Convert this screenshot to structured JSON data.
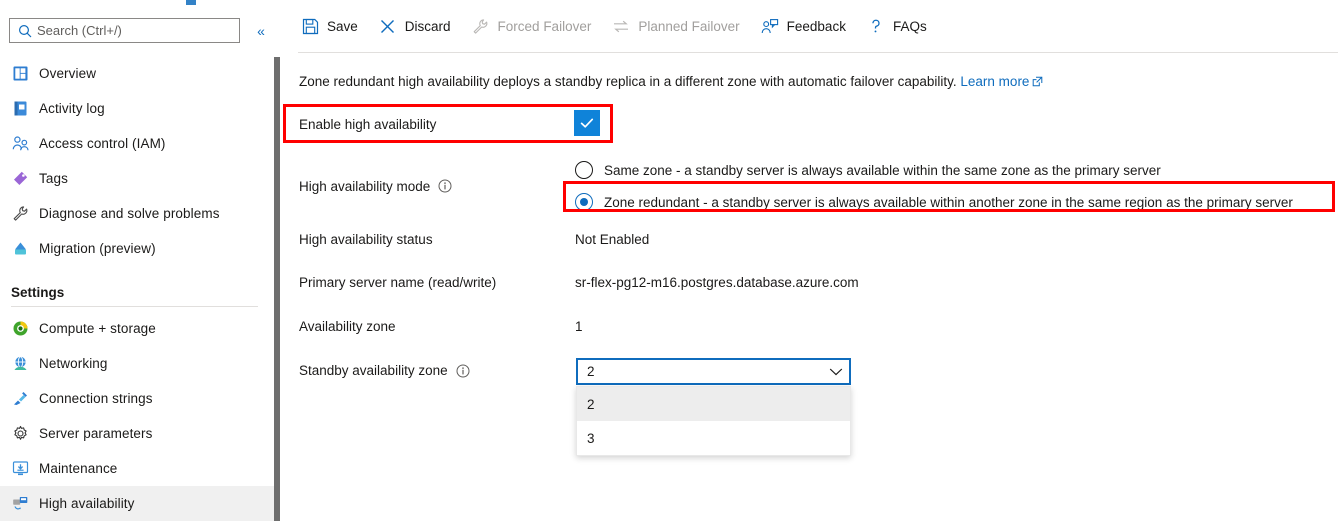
{
  "sidebar": {
    "search": {
      "placeholder": "Search (Ctrl+/)",
      "value": "",
      "icon": "search-icon"
    },
    "collapse_label": "«",
    "items": [
      {
        "label": "Overview",
        "icon": "overview-icon"
      },
      {
        "label": "Activity log",
        "icon": "activity-log-icon"
      },
      {
        "label": "Access control (IAM)",
        "icon": "access-control-icon"
      },
      {
        "label": "Tags",
        "icon": "tag-icon"
      },
      {
        "label": "Diagnose and solve problems",
        "icon": "wrench-icon"
      },
      {
        "label": "Migration (preview)",
        "icon": "migration-icon"
      }
    ],
    "section_title": "Settings",
    "settings_items": [
      {
        "label": "Compute + storage",
        "icon": "compute-storage-icon",
        "selected": false
      },
      {
        "label": "Networking",
        "icon": "networking-icon",
        "selected": false
      },
      {
        "label": "Connection strings",
        "icon": "connection-strings-icon",
        "selected": false
      },
      {
        "label": "Server parameters",
        "icon": "gear-icon",
        "selected": false
      },
      {
        "label": "Maintenance",
        "icon": "maintenance-icon",
        "selected": false
      },
      {
        "label": "High availability",
        "icon": "high-availability-icon",
        "selected": true
      }
    ]
  },
  "toolbar": {
    "save_label": "Save",
    "discard_label": "Discard",
    "forced_failover_label": "Forced Failover",
    "planned_failover_label": "Planned Failover",
    "feedback_label": "Feedback",
    "faqs_label": "FAQs"
  },
  "main": {
    "description_text": "Zone redundant high availability deploys a standby replica in a different zone with automatic failover capability.",
    "learn_more_label": "Learn more",
    "enable_ha": {
      "label": "Enable high availability",
      "checked": true
    },
    "ha_mode": {
      "label": "High availability mode",
      "options": [
        {
          "label": "Same zone - a standby server is always available within the same zone as the primary server",
          "selected": false
        },
        {
          "label": "Zone redundant - a standby server is always available within another zone in the same region as the primary server",
          "selected": true
        }
      ]
    },
    "ha_status": {
      "label": "High availability status",
      "value": "Not Enabled"
    },
    "primary_server": {
      "label": "Primary server name (read/write)",
      "value": "sr-flex-pg12-m16.postgres.database.azure.com"
    },
    "availability_zone": {
      "label": "Availability zone",
      "value": "1"
    },
    "standby_zone": {
      "label": "Standby availability zone",
      "value": "2",
      "options": [
        {
          "label": "2",
          "active": true
        },
        {
          "label": "3",
          "active": false
        }
      ]
    }
  },
  "colors": {
    "accent": "#0f6cbd",
    "checkbox": "#0f83d9",
    "annotation": "#ff0000",
    "disabled_text": "#a19f9d",
    "selected_row": "#f0f0f0"
  }
}
